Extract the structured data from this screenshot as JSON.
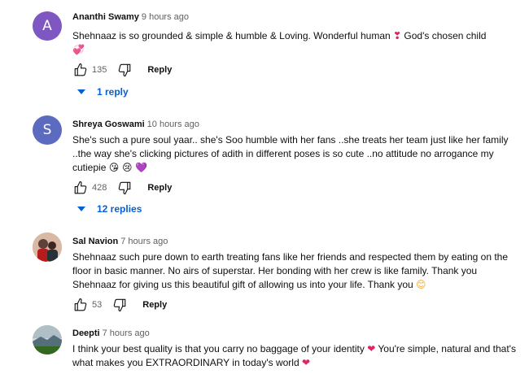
{
  "comments": [
    {
      "author": "Ananthi Swamy",
      "time": "9 hours ago",
      "avatar_letter": "A",
      "avatar_color": "#7e57c2",
      "text_parts": [
        "Shehnaaz is so grounded & simple & humble & Loving. Wonderful human ",
        "❣",
        " God's chosen child ",
        "💞"
      ],
      "likes": "135",
      "reply_label": "Reply",
      "replies": "1 reply"
    },
    {
      "author": "Shreya Goswami",
      "time": "10 hours ago",
      "avatar_letter": "S",
      "avatar_color": "#5c6bc0",
      "text_parts": [
        "She's such a pure soul yaar.. she's Soo humble with her fans ..she treats her team just like her family ..the way she's clicking pictures of adith in different poses is so cute ..no attitude no arrogance my cutiepie ",
        "😘 😢 💜"
      ],
      "likes": "428",
      "reply_label": "Reply",
      "replies": "12 replies"
    },
    {
      "author": "Sal Navion",
      "time": "7 hours ago",
      "avatar_color": "#8d6e63",
      "text_parts": [
        "Shehnaaz such pure down to earth treating fans like her friends and respected them by eating on the floor in basic manner. No airs of superstar. Her bonding with her crew is like family. Thank you Shehnaaz for giving us this beautiful gift of allowing us into your life. Thank you ",
        "😊"
      ],
      "likes": "53",
      "reply_label": "Reply"
    },
    {
      "author": "Deepti",
      "time": "7 hours ago",
      "avatar_color": "#78909c",
      "text_parts": [
        "I think your best quality is that you carry no baggage of your identity ",
        "❤",
        " You're simple, natural and that's what makes you EXTRAORDINARY in today's world ",
        "❤"
      ]
    }
  ],
  "colors": {
    "link_blue": "#065fd4",
    "text": "#0f0f0f",
    "secondary": "#606060"
  }
}
